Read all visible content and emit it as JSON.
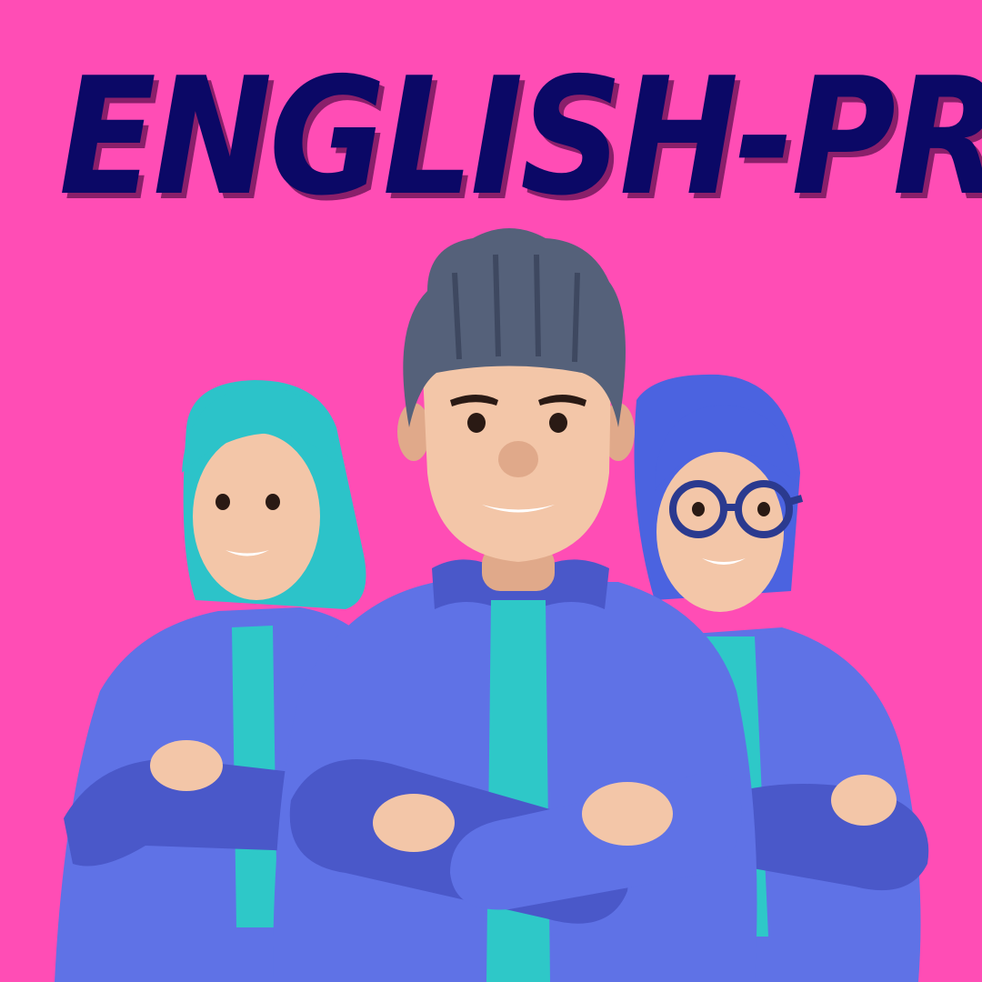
{
  "title": "ENGLISH-PRO",
  "colors": {
    "background": "#ff4db5",
    "title_text": "#0b0866",
    "title_shadow": "#8a1f6a",
    "jacket": "#5f72e6",
    "jacket_shade": "#4a58c9",
    "shirt": "#2ec8c8",
    "skin": "#f3c6a8",
    "skin_shade": "#e0a98a",
    "hair_teal": "#2cc3c9",
    "hair_gray": "#55617a",
    "hair_blue": "#4b63e0",
    "glasses": "#2b3a8f"
  },
  "figures": [
    {
      "name": "left-person",
      "hair": "teal"
    },
    {
      "name": "center-person",
      "hair": "gray"
    },
    {
      "name": "right-person",
      "hair": "blue",
      "accessory": "glasses"
    }
  ]
}
